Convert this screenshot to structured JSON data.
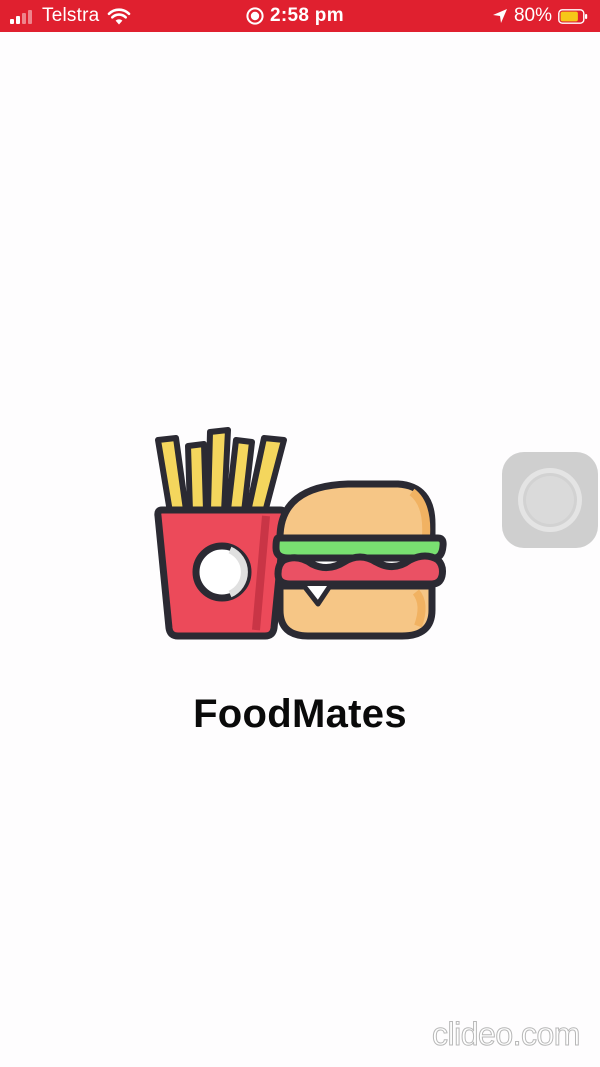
{
  "status_bar": {
    "carrier": "Telstra",
    "time": "2:58 pm",
    "battery_percent": "80%",
    "battery_level": 0.8,
    "signal_bars_active": 2,
    "background_color": "#e0202f"
  },
  "app": {
    "name": "FoodMates",
    "logo_icon": "fries-and-burger-icon"
  },
  "overlay": {
    "assistive_touch_icon": "assistive-touch-icon"
  },
  "watermark": {
    "text": "clideo.com"
  }
}
